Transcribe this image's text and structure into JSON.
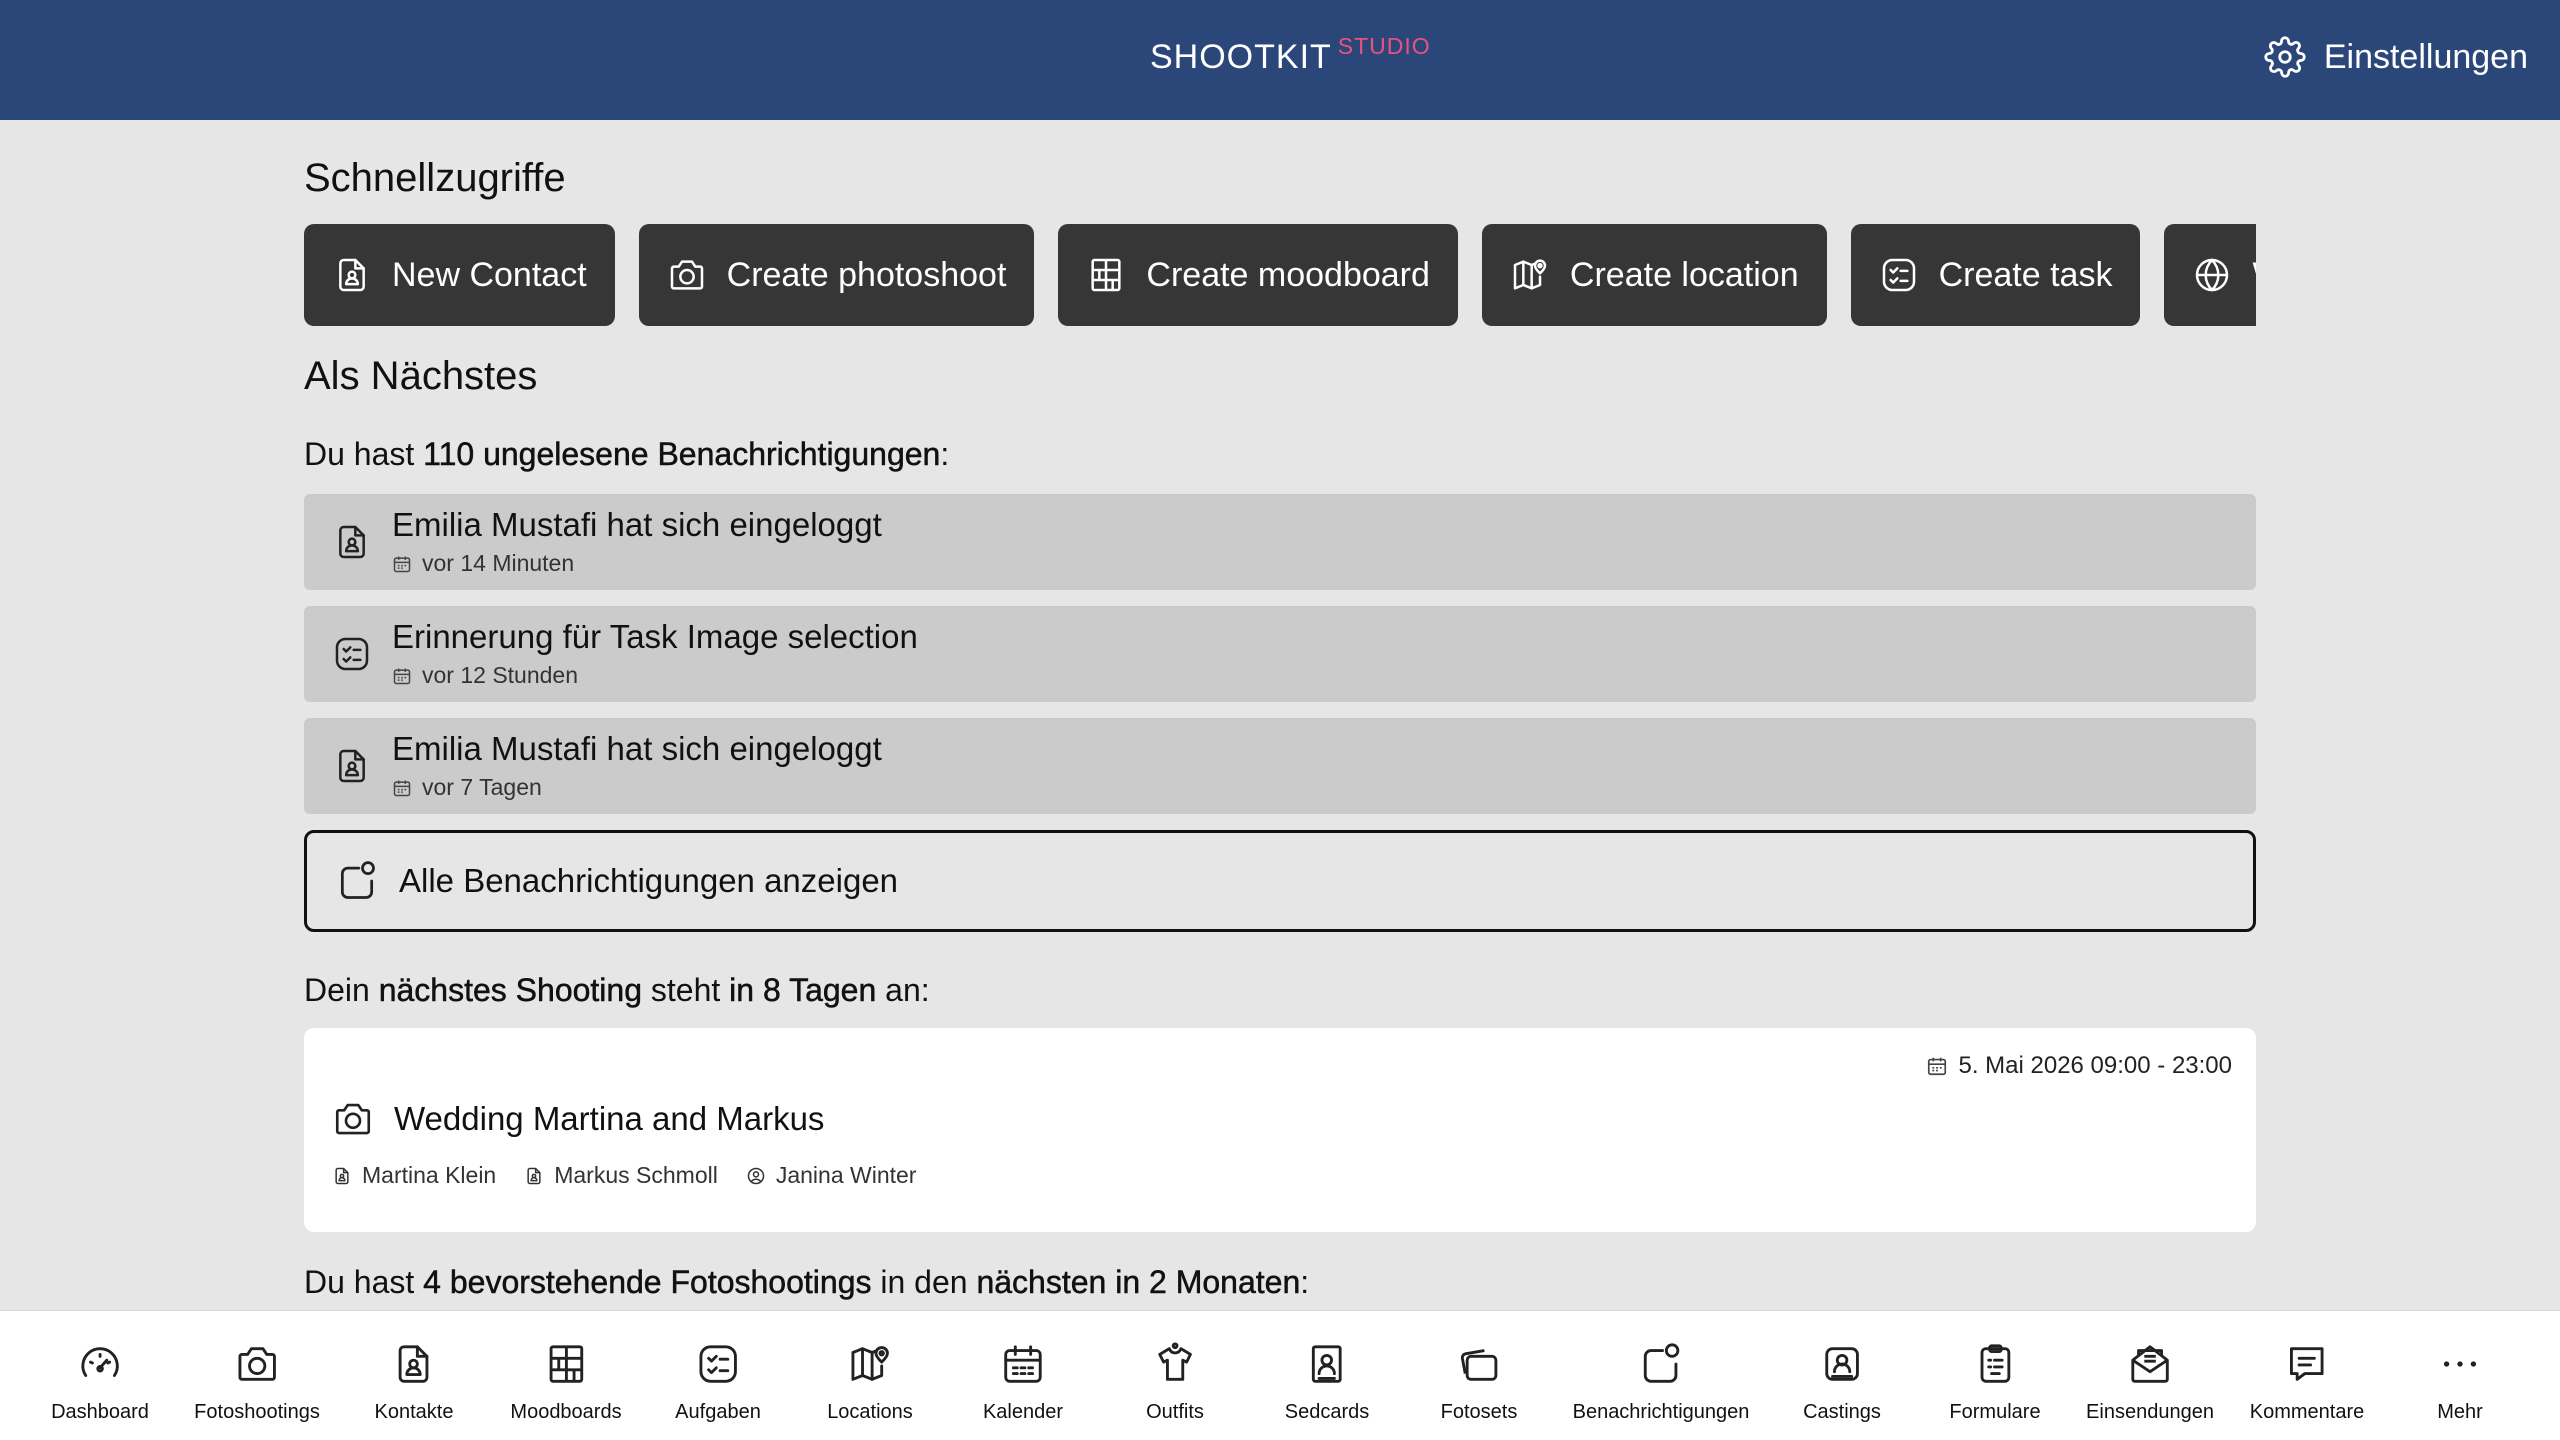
{
  "header": {
    "brand": "SHOOTKIT",
    "brand_sup": "STUDIO",
    "settings_label": "Einstellungen"
  },
  "quick_access": {
    "title": "Schnellzugriffe",
    "buttons": [
      {
        "label": "New Contact",
        "icon": "contact-file-icon"
      },
      {
        "label": "Create photoshoot",
        "icon": "camera-icon"
      },
      {
        "label": "Create moodboard",
        "icon": "moodboard-grid-icon"
      },
      {
        "label": "Create location",
        "icon": "map-pin-icon"
      },
      {
        "label": "Create task",
        "icon": "task-list-icon"
      },
      {
        "label": "W",
        "icon": "globe-icon"
      }
    ]
  },
  "next": {
    "title": "Als Nächstes",
    "notifications_intro": {
      "pre": "Du hast ",
      "strong": "110 ungelesene Benachrichtigungen",
      "post": ":"
    },
    "notifications": [
      {
        "title": "Emilia Mustafi hat sich eingeloggt",
        "time": "vor 14 Minuten",
        "icon": "contact-file-icon"
      },
      {
        "title": "Erinnerung für Task Image selection",
        "time": "vor 12 Stunden",
        "icon": "task-list-icon"
      },
      {
        "title": "Emilia Mustafi hat sich eingeloggt",
        "time": "vor 7 Tagen",
        "icon": "contact-file-icon"
      }
    ],
    "all_notifications_label": "Alle Benachrichtigungen anzeigen",
    "shooting_intro": {
      "pre": "Dein ",
      "strong1": "nächstes Shooting",
      "mid": " steht ",
      "strong2": "in 8 Tagen",
      "post": " an:"
    },
    "next_shooting": {
      "date": "5. Mai 2026 09:00 - 23:00",
      "title": "Wedding Martina and Markus",
      "people": [
        {
          "name": "Martina Klein",
          "icon": "contact-file-icon"
        },
        {
          "name": "Markus Schmoll",
          "icon": "contact-file-icon"
        },
        {
          "name": "Janina Winter",
          "icon": "user-circle-icon"
        }
      ]
    },
    "upcoming_intro": {
      "pre": "Du hast ",
      "strong1": "4 bevorstehende Fotoshootings",
      "mid": " in den ",
      "strong2": "nächsten in 2 Monaten",
      "post": ":"
    }
  },
  "bottom_nav": [
    {
      "label": "Dashboard",
      "icon": "dashboard-gauge-icon"
    },
    {
      "label": "Fotoshootings",
      "icon": "camera-icon"
    },
    {
      "label": "Kontakte",
      "icon": "contact-file-icon"
    },
    {
      "label": "Moodboards",
      "icon": "moodboard-grid-icon"
    },
    {
      "label": "Aufgaben",
      "icon": "task-list-icon"
    },
    {
      "label": "Locations",
      "icon": "map-pin-icon"
    },
    {
      "label": "Kalender",
      "icon": "calendar-icon"
    },
    {
      "label": "Outfits",
      "icon": "shirt-icon"
    },
    {
      "label": "Sedcards",
      "icon": "sedcard-icon"
    },
    {
      "label": "Fotosets",
      "icon": "photosets-icon"
    },
    {
      "label": "Benachrichtigungen",
      "icon": "notification-icon"
    },
    {
      "label": "Castings",
      "icon": "casting-icon"
    },
    {
      "label": "Formulare",
      "icon": "clipboard-icon"
    },
    {
      "label": "Einsendungen",
      "icon": "mail-open-icon"
    },
    {
      "label": "Kommentare",
      "icon": "comment-icon"
    },
    {
      "label": "Mehr",
      "icon": "more-dots-icon"
    }
  ]
}
